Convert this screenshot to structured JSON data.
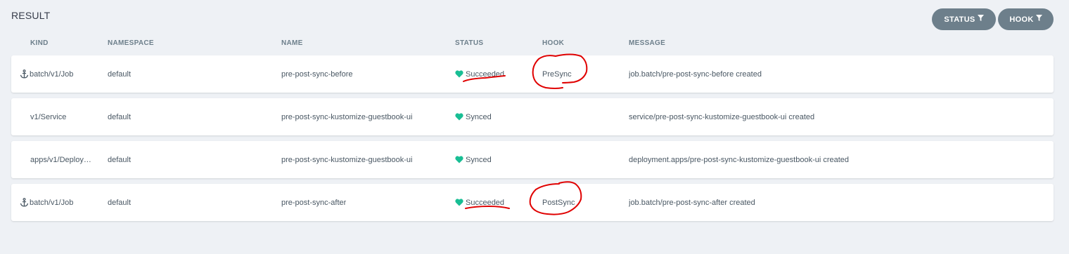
{
  "page": {
    "title": "RESULT",
    "accent_color": "#18be94",
    "annotation_color": "#e00000"
  },
  "filters": {
    "status_label": "STATUS",
    "hook_label": "HOOK"
  },
  "table": {
    "headers": {
      "kind": "KIND",
      "namespace": "NAMESPACE",
      "name": "NAME",
      "status": "STATUS",
      "hook": "HOOK",
      "message": "MESSAGE"
    },
    "rows": [
      {
        "icon": "anchor-icon",
        "kind": "batch/v1/Job",
        "namespace": "default",
        "name": "pre-post-sync-before",
        "status": "Succeeded",
        "hook": "PreSync",
        "message": "job.batch/pre-post-sync-before created"
      },
      {
        "icon": "",
        "kind": "v1/Service",
        "namespace": "default",
        "name": "pre-post-sync-kustomize-guestbook-ui",
        "status": "Synced",
        "hook": "",
        "message": "service/pre-post-sync-kustomize-guestbook-ui created"
      },
      {
        "icon": "",
        "kind": "apps/v1/Deploy…",
        "namespace": "default",
        "name": "pre-post-sync-kustomize-guestbook-ui",
        "status": "Synced",
        "hook": "",
        "message": "deployment.apps/pre-post-sync-kustomize-guestbook-ui created"
      },
      {
        "icon": "anchor-icon",
        "kind": "batch/v1/Job",
        "namespace": "default",
        "name": "pre-post-sync-after",
        "status": "Succeeded",
        "hook": "PostSync",
        "message": "job.batch/pre-post-sync-after created"
      }
    ]
  }
}
